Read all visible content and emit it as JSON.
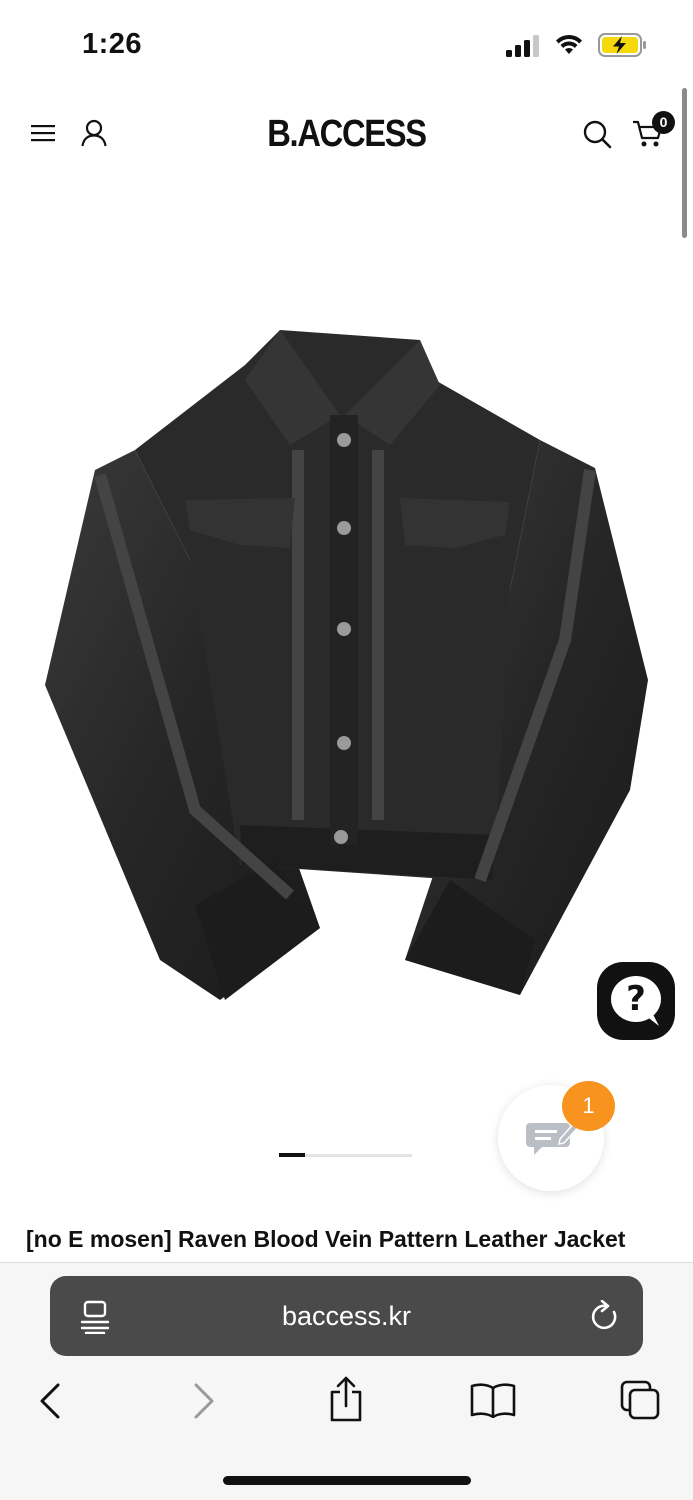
{
  "status_bar": {
    "time": "1:26"
  },
  "header": {
    "logo": "B.ACCESS",
    "cart_count": "0",
    "icons": [
      "menu-icon",
      "user-icon",
      "search-icon",
      "cart-icon"
    ]
  },
  "product": {
    "title": "[no E mosen] Raven Blood Vein Pattern Leather Jacket",
    "image_subject": "black leather trucker jacket",
    "carousel": {
      "current": 1
    }
  },
  "floating": {
    "help_icon": "?",
    "chat_badge": "1"
  },
  "browser": {
    "url": "baccess.kr",
    "toolbar": [
      "back",
      "forward",
      "share",
      "bookmarks",
      "tabs"
    ]
  },
  "colors": {
    "accent_orange": "#f7931e",
    "url_bar": "#4a4a4a",
    "battery_yellow": "#f5d90a"
  }
}
